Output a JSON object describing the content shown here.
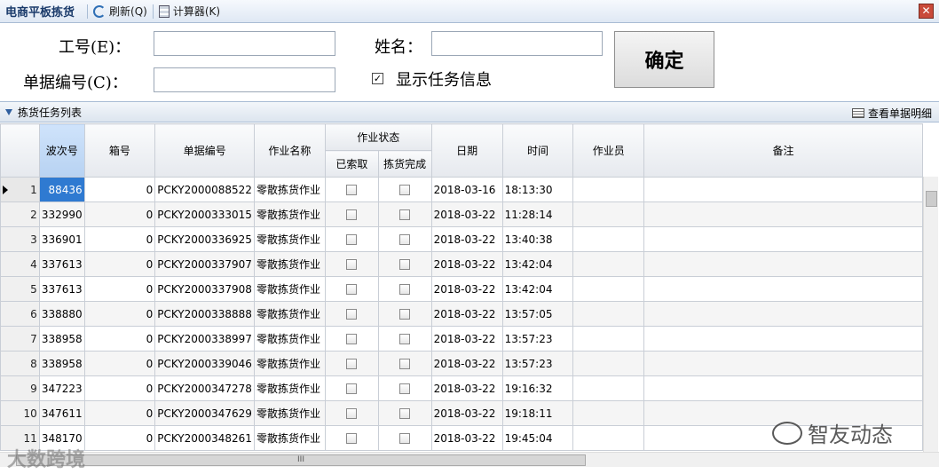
{
  "toolbar": {
    "title": "电商平板拣货",
    "refresh_label": "刷新(Q)",
    "calculator_label": "计算器(K)",
    "close_label": "✕"
  },
  "form": {
    "employee_label": "工号(E)：",
    "employee_value": "",
    "name_label": "姓名：",
    "name_value": "",
    "doc_label": "单据编号(C)：",
    "doc_value": "",
    "show_task_label": "显示任务信息",
    "show_task_checked": true,
    "ok_label": "确定"
  },
  "panel": {
    "title": "拣货任务列表",
    "detail_label": "查看单据明细"
  },
  "grid": {
    "headers": {
      "wave": "波次号",
      "box": "箱号",
      "doc": "单据编号",
      "op_name": "作业名称",
      "op_status": "作业状态",
      "claimed": "已索取",
      "picked": "拣货完成",
      "date": "日期",
      "time": "时间",
      "operator": "作业员",
      "remark": "备注"
    },
    "rows": [
      {
        "idx": "1",
        "wave": "88436",
        "box": "0",
        "doc": "PCKY2000088522",
        "op": "零散拣货作业",
        "date": "2018-03-16",
        "time": "18:13:30"
      },
      {
        "idx": "2",
        "wave": "332990",
        "box": "0",
        "doc": "PCKY2000333015",
        "op": "零散拣货作业",
        "date": "2018-03-22",
        "time": "11:28:14"
      },
      {
        "idx": "3",
        "wave": "336901",
        "box": "0",
        "doc": "PCKY2000336925",
        "op": "零散拣货作业",
        "date": "2018-03-22",
        "time": "13:40:38"
      },
      {
        "idx": "4",
        "wave": "337613",
        "box": "0",
        "doc": "PCKY2000337907",
        "op": "零散拣货作业",
        "date": "2018-03-22",
        "time": "13:42:04"
      },
      {
        "idx": "5",
        "wave": "337613",
        "box": "0",
        "doc": "PCKY2000337908",
        "op": "零散拣货作业",
        "date": "2018-03-22",
        "time": "13:42:04"
      },
      {
        "idx": "6",
        "wave": "338880",
        "box": "0",
        "doc": "PCKY2000338888",
        "op": "零散拣货作业",
        "date": "2018-03-22",
        "time": "13:57:05"
      },
      {
        "idx": "7",
        "wave": "338958",
        "box": "0",
        "doc": "PCKY2000338997",
        "op": "零散拣货作业",
        "date": "2018-03-22",
        "time": "13:57:23"
      },
      {
        "idx": "8",
        "wave": "338958",
        "box": "0",
        "doc": "PCKY2000339046",
        "op": "零散拣货作业",
        "date": "2018-03-22",
        "time": "13:57:23"
      },
      {
        "idx": "9",
        "wave": "347223",
        "box": "0",
        "doc": "PCKY2000347278",
        "op": "零散拣货作业",
        "date": "2018-03-22",
        "time": "19:16:32"
      },
      {
        "idx": "10",
        "wave": "347611",
        "box": "0",
        "doc": "PCKY2000347629",
        "op": "零散拣货作业",
        "date": "2018-03-22",
        "time": "19:18:11"
      },
      {
        "idx": "11",
        "wave": "348170",
        "box": "0",
        "doc": "PCKY2000348261",
        "op": "零散拣货作业",
        "date": "2018-03-22",
        "time": "19:45:04"
      }
    ]
  },
  "hscroll_grip": "III",
  "watermarks": {
    "left": "大数跨境",
    "right": "智友动态"
  },
  "colors": {
    "selected_cell": "#2f7ad1",
    "toolbar_title": "#1a3a6a"
  }
}
